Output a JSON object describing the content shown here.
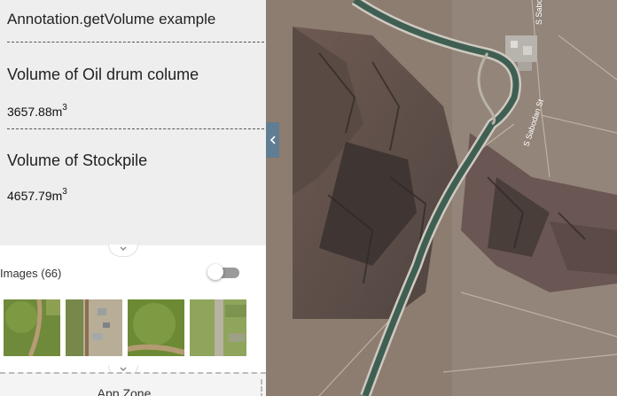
{
  "panel": {
    "title": "Annotation.getVolume example",
    "volumes": [
      {
        "label": "Volume of Oil drum colume",
        "value": "3657.88m",
        "unit_sup": "3"
      },
      {
        "label": "Volume of Stockpile",
        "value": "4657.79m",
        "unit_sup": "3"
      }
    ]
  },
  "images": {
    "title": "Images (66)",
    "toggle_on": false
  },
  "app_zone": {
    "label": "App Zone"
  },
  "map": {
    "street_labels": [
      "S Sabodan St",
      "S Sabo"
    ]
  },
  "icons": {
    "collapse": "chevron-down-icon",
    "side_toggle": "chevron-left-icon"
  },
  "colors": {
    "info_bg": "#eeeeee",
    "side_toggle": "#5f7d93",
    "toggle_track": "#9a9a9a"
  }
}
